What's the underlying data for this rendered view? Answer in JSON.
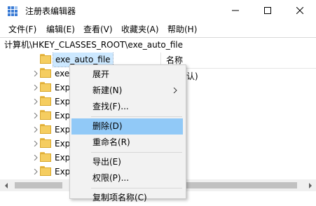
{
  "window": {
    "title": "注册表编辑器",
    "minimize_icon": "minimize-icon",
    "maximize_icon": "maximize-icon",
    "close_icon": "close-icon"
  },
  "menubar": {
    "items": [
      "文件(F)",
      "编辑(E)",
      "查看(V)",
      "收藏夹(A)",
      "帮助(H)"
    ]
  },
  "address": {
    "path": "计算机\\HKEY_CLASSES_ROOT\\exe_auto_file"
  },
  "tree": {
    "items": [
      {
        "label": "exe_auto_file",
        "selected": true
      },
      {
        "label": "exe"
      },
      {
        "label": "Exp"
      },
      {
        "label": "Exp"
      },
      {
        "label": "Exp"
      },
      {
        "label": "Exp"
      },
      {
        "label": "Exp"
      },
      {
        "label": "Exp"
      },
      {
        "label": "Exp"
      }
    ]
  },
  "right_pane": {
    "column_name": "名称",
    "value_fragment": "默认)"
  },
  "context_menu": {
    "items": [
      {
        "label": "展开"
      },
      {
        "label": "新建(N)",
        "submenu": true
      },
      {
        "label": "查找(F)..."
      },
      {
        "label": "删除(D)",
        "highlighted": true
      },
      {
        "label": "重命名(R)"
      },
      {
        "label": "导出(E)"
      },
      {
        "label": "权限(P)..."
      },
      {
        "label": "复制项名称(C)"
      }
    ]
  },
  "colors": {
    "highlight": "#91c9f7",
    "selection": "#cce8ff",
    "folder": "#f5cd60",
    "menu_bg": "#f2f2f2"
  }
}
